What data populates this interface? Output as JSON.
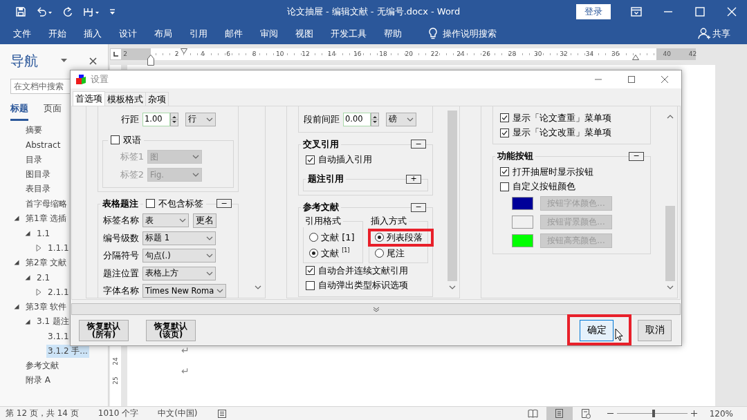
{
  "title_bar": {
    "title": "论文抽屉 - 编辑文献 - 无编号.docx - Word",
    "sign_in": "登录"
  },
  "ribbon": {
    "tabs": [
      "文件",
      "开始",
      "插入",
      "设计",
      "布局",
      "引用",
      "邮件",
      "审阅",
      "视图",
      "开发工具",
      "帮助"
    ],
    "tell_me": "操作说明搜索",
    "share": "共享"
  },
  "navigation": {
    "title": "导航",
    "search": {
      "placeholder": "在文档中搜索"
    },
    "tabs": [
      {
        "label": "标题",
        "selected": true
      },
      {
        "label": "页面",
        "selected": false
      }
    ],
    "headings": [
      {
        "label": "摘要",
        "expandable": false,
        "selected": false
      },
      {
        "label": "Abstract",
        "expandable": false,
        "selected": false
      },
      {
        "label": "目录",
        "expandable": false,
        "selected": false
      },
      {
        "label": "图目录",
        "expandable": false,
        "selected": false
      },
      {
        "label": "表目录",
        "expandable": false,
        "selected": false
      },
      {
        "label": "首字母缩略",
        "expandable": false,
        "selected": false
      },
      {
        "label": "第1章 选插",
        "expandable": true,
        "expanded": true,
        "selected": false,
        "children": [
          {
            "label": "1.1",
            "expandable": true,
            "expanded": true,
            "selected": false,
            "children": [
              {
                "label": "1.1.1",
                "expandable": true,
                "expanded": false,
                "selected": false
              }
            ]
          }
        ]
      },
      {
        "label": "第2章 文献",
        "expandable": true,
        "expanded": true,
        "selected": false,
        "children": [
          {
            "label": "2.1",
            "expandable": true,
            "expanded": true,
            "selected": false,
            "children": [
              {
                "label": "2.1.1",
                "expandable": true,
                "expanded": false,
                "selected": false
              }
            ]
          }
        ]
      },
      {
        "label": "第3章 软件",
        "expandable": true,
        "expanded": true,
        "selected": false,
        "children": [
          {
            "label": "3.1 题注",
            "expandable": true,
            "expanded": true,
            "selected": false,
            "children": [
              {
                "label": "3.1.1",
                "expandable": false,
                "selected": false
              },
              {
                "label": "3.1.2 手...",
                "expandable": false,
                "selected": true
              }
            ]
          }
        ]
      },
      {
        "label": "参考文献",
        "expandable": false,
        "selected": false
      },
      {
        "label": "附录 A",
        "expandable": false,
        "selected": false
      }
    ]
  },
  "ruler": {
    "numbers": [
      "2",
      "2",
      "4",
      "6",
      "8",
      "10",
      "12",
      "14",
      "16",
      "18",
      "20",
      "22",
      "24",
      "26",
      "28",
      "30",
      "32",
      "34",
      "36",
      "40",
      "42"
    ]
  },
  "document": {
    "line_numbers": [
      "24",
      "25"
    ],
    "paragraph_marks": [
      "↵",
      "↵"
    ]
  },
  "dialog": {
    "title": "设置",
    "tabs": [
      {
        "label": "首选项",
        "selected": true
      },
      {
        "label": "模板格式",
        "selected": false
      },
      {
        "label": "杂项",
        "selected": false
      }
    ],
    "panels": [
      {
        "items": [
          {
            "kind": "group",
            "items": [
              {
                "kind": "spin",
                "label": "行距",
                "value": "1.00",
                "unit": "行"
              },
              {
                "kind": "group",
                "checkbox": {
                  "label": "双语",
                  "checked": false
                },
                "items": [
                  {
                    "kind": "select",
                    "label": "标签1",
                    "value": "图",
                    "disabled": true
                  },
                  {
                    "kind": "select",
                    "label": "标签2",
                    "value": "Fig.",
                    "disabled": true
                  }
                ]
              }
            ]
          },
          {
            "kind": "group",
            "title": "表格题注",
            "checkbox": {
              "label": "不包含标签",
              "checked": false
            },
            "collapse": "−",
            "items": [
              {
                "kind": "select",
                "label": "标签名称",
                "value": "表",
                "button": "更名",
                "disabled": false
              },
              {
                "kind": "select",
                "label": "编号级数",
                "value": "标题 1",
                "disabled": false
              },
              {
                "kind": "select",
                "label": "分隔符号",
                "value": "句点(.)",
                "disabled": false
              },
              {
                "kind": "select",
                "label": "题注位置",
                "value": "表格上方",
                "disabled": false
              },
              {
                "kind": "select",
                "label": "字体名称",
                "value": "Times New Roma",
                "disabled": false
              }
            ]
          }
        ]
      },
      {
        "items": [
          {
            "kind": "group",
            "items": [
              {
                "kind": "spin",
                "label": "段前间距",
                "value": "0.00",
                "unit": "磅"
              }
            ]
          },
          {
            "kind": "group",
            "title": "交叉引用",
            "collapse": "−",
            "items": [
              {
                "kind": "checkbox",
                "label": "自动插入引用",
                "checked": true
              },
              {
                "kind": "group",
                "title": "题注引用",
                "collapse": "+"
              }
            ]
          },
          {
            "kind": "group",
            "title": "参考文献",
            "collapse": "−",
            "items": [
              {
                "kind": "columns",
                "items": [
                  {
                    "kind": "subgroup",
                    "title": "引用格式",
                    "items": [
                      {
                        "kind": "radio",
                        "label": "文献 [1]",
                        "selected": false,
                        "highlighted": false
                      },
                      {
                        "kind": "radio",
                        "label": "文献 $^{[1]}$",
                        "selected": true,
                        "highlighted": false
                      }
                    ]
                  },
                  {
                    "kind": "subgroup",
                    "title": "插入方式",
                    "items": [
                      {
                        "kind": "radio",
                        "label": "列表段落",
                        "selected": true,
                        "highlighted": true
                      },
                      {
                        "kind": "radio",
                        "label": "尾注",
                        "selected": false,
                        "highlighted": false
                      }
                    ]
                  }
                ]
              },
              {
                "kind": "checkbox",
                "label": "自动合并连续文献引用",
                "checked": true
              },
              {
                "kind": "checkbox",
                "label": "自动弹出类型标识选项",
                "checked": false
              }
            ]
          }
        ]
      },
      {
        "items": [
          {
            "kind": "group",
            "items": [
              {
                "kind": "checkbox",
                "label": "显示「论文查重」菜单项",
                "checked": true
              },
              {
                "kind": "checkbox",
                "label": "显示「论文改重」菜单项",
                "checked": true
              }
            ]
          },
          {
            "kind": "group",
            "title": "功能按钮",
            "collapse": "−",
            "items": [
              {
                "kind": "checkbox",
                "label": "打开抽屉时显示按钮",
                "checked": true
              },
              {
                "kind": "checkbox",
                "label": "自定义按钮颜色",
                "checked": false
              },
              {
                "kind": "color",
                "color": "#000099",
                "button": "按钮字体颜色...",
                "disabled": true
              },
              {
                "kind": "color",
                "color": "#f0f0f0",
                "button": "按钮背景颜色...",
                "disabled": true
              },
              {
                "kind": "color",
                "color": "#00ff00",
                "button": "按钮高亮颜色...",
                "disabled": true
              }
            ]
          }
        ]
      }
    ],
    "buttons": [
      {
        "label": "恢复默认\n(所有)",
        "kind": "reset",
        "focused": false,
        "highlighted": false
      },
      {
        "label": "恢复默认\n(该页)",
        "kind": "reset",
        "focused": false,
        "highlighted": false
      },
      {
        "label": "确定",
        "kind": "ok",
        "focused": true,
        "highlighted": true
      },
      {
        "label": "取消",
        "kind": "cancel",
        "focused": false,
        "highlighted": false
      }
    ]
  },
  "status_bar": {
    "page": "第 12 页，共 14 页",
    "words": "1010 个字",
    "language": "中文(中国)",
    "views": [
      {
        "selected": false
      },
      {
        "selected": true
      },
      {
        "selected": false
      }
    ],
    "zoom": {
      "level": 0.52,
      "reading": "120%"
    }
  }
}
